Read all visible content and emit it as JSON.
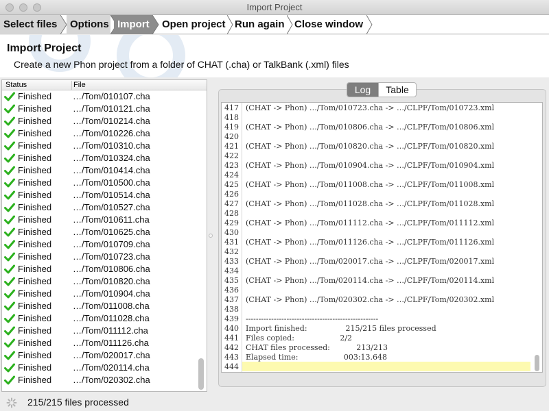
{
  "window": {
    "title": "Import Project"
  },
  "steps": [
    "Select files",
    "Options",
    "Import",
    "Open project",
    "Run again",
    "Close window"
  ],
  "header": {
    "title": "Import Project",
    "description": "Create a new Phon project from a folder of CHAT (.cha) or TalkBank (.xml) files"
  },
  "files_table": {
    "columns": {
      "status": "Status",
      "file": "File"
    },
    "rows": [
      {
        "status": "Finished",
        "file": "…/Tom/010107.cha"
      },
      {
        "status": "Finished",
        "file": "…/Tom/010121.cha"
      },
      {
        "status": "Finished",
        "file": "…/Tom/010214.cha"
      },
      {
        "status": "Finished",
        "file": "…/Tom/010226.cha"
      },
      {
        "status": "Finished",
        "file": "…/Tom/010310.cha"
      },
      {
        "status": "Finished",
        "file": "…/Tom/010324.cha"
      },
      {
        "status": "Finished",
        "file": "…/Tom/010414.cha"
      },
      {
        "status": "Finished",
        "file": "…/Tom/010500.cha"
      },
      {
        "status": "Finished",
        "file": "…/Tom/010514.cha"
      },
      {
        "status": "Finished",
        "file": "…/Tom/010527.cha"
      },
      {
        "status": "Finished",
        "file": "…/Tom/010611.cha"
      },
      {
        "status": "Finished",
        "file": "…/Tom/010625.cha"
      },
      {
        "status": "Finished",
        "file": "…/Tom/010709.cha"
      },
      {
        "status": "Finished",
        "file": "…/Tom/010723.cha"
      },
      {
        "status": "Finished",
        "file": "…/Tom/010806.cha"
      },
      {
        "status": "Finished",
        "file": "…/Tom/010820.cha"
      },
      {
        "status": "Finished",
        "file": "…/Tom/010904.cha"
      },
      {
        "status": "Finished",
        "file": "…/Tom/011008.cha"
      },
      {
        "status": "Finished",
        "file": "…/Tom/011028.cha"
      },
      {
        "status": "Finished",
        "file": "…/Tom/011112.cha"
      },
      {
        "status": "Finished",
        "file": "…/Tom/011126.cha"
      },
      {
        "status": "Finished",
        "file": "…/Tom/020017.cha"
      },
      {
        "status": "Finished",
        "file": "…/Tom/020114.cha"
      },
      {
        "status": "Finished",
        "file": "…/Tom/020302.cha"
      }
    ]
  },
  "log_tabs": {
    "log": "Log",
    "table": "Table",
    "selected": "Log"
  },
  "log_lines": [
    {
      "n": "417",
      "text": "(CHAT -> Phon) …/Tom/010723.cha -> …/CLPF/Tom/010723.xml"
    },
    {
      "n": "418",
      "text": ""
    },
    {
      "n": "419",
      "text": "(CHAT -> Phon) …/Tom/010806.cha -> …/CLPF/Tom/010806.xml"
    },
    {
      "n": "420",
      "text": ""
    },
    {
      "n": "421",
      "text": "(CHAT -> Phon) …/Tom/010820.cha -> …/CLPF/Tom/010820.xml"
    },
    {
      "n": "422",
      "text": ""
    },
    {
      "n": "423",
      "text": "(CHAT -> Phon) …/Tom/010904.cha -> …/CLPF/Tom/010904.xml"
    },
    {
      "n": "424",
      "text": ""
    },
    {
      "n": "425",
      "text": "(CHAT -> Phon) …/Tom/011008.cha -> …/CLPF/Tom/011008.xml"
    },
    {
      "n": "426",
      "text": ""
    },
    {
      "n": "427",
      "text": "(CHAT -> Phon) …/Tom/011028.cha -> …/CLPF/Tom/011028.xml"
    },
    {
      "n": "428",
      "text": ""
    },
    {
      "n": "429",
      "text": "(CHAT -> Phon) …/Tom/011112.cha -> …/CLPF/Tom/011112.xml"
    },
    {
      "n": "430",
      "text": ""
    },
    {
      "n": "431",
      "text": "(CHAT -> Phon) …/Tom/011126.cha -> …/CLPF/Tom/011126.xml"
    },
    {
      "n": "432",
      "text": ""
    },
    {
      "n": "433",
      "text": "(CHAT -> Phon) …/Tom/020017.cha -> …/CLPF/Tom/020017.xml"
    },
    {
      "n": "434",
      "text": ""
    },
    {
      "n": "435",
      "text": "(CHAT -> Phon) …/Tom/020114.cha -> …/CLPF/Tom/020114.xml"
    },
    {
      "n": "436",
      "text": ""
    },
    {
      "n": "437",
      "text": "(CHAT -> Phon) …/Tom/020302.cha -> …/CLPF/Tom/020302.xml"
    },
    {
      "n": "438",
      "text": ""
    },
    {
      "n": "439",
      "text": "----------------------------------------------------"
    },
    {
      "n": "440",
      "text": "Import finished:                215/215 files processed"
    },
    {
      "n": "441",
      "text": "Files copied:                   2/2"
    },
    {
      "n": "442",
      "text": "CHAT files processed:           213/213"
    },
    {
      "n": "443",
      "text": "Elapsed time:                   003:13.648"
    },
    {
      "n": "444",
      "text": ""
    }
  ],
  "status_bar": {
    "text": "215/215 files processed"
  },
  "colors": {
    "check_green": "#2bb11d",
    "active_step": "#8d8d8d",
    "log_highlight": "#fdfab0"
  }
}
